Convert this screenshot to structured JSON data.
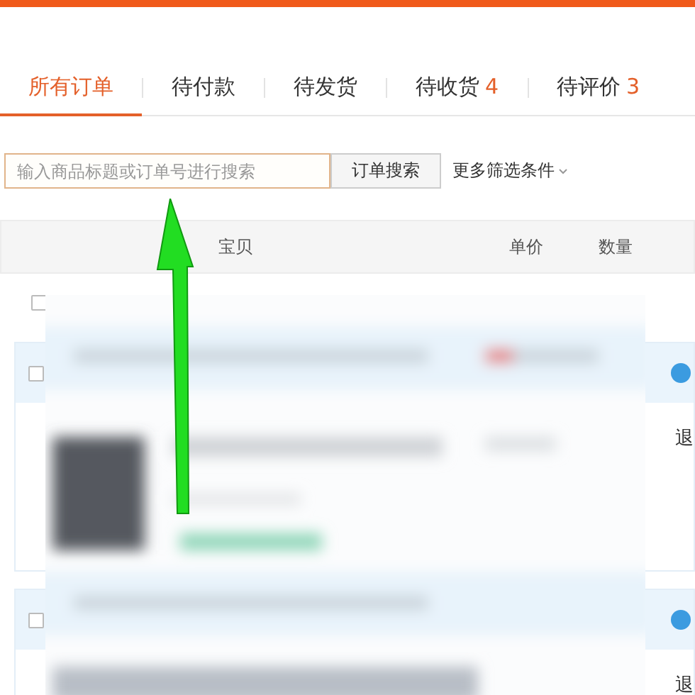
{
  "tabs": [
    {
      "label": "所有订单",
      "selected": true
    },
    {
      "label": "待付款",
      "selected": false
    },
    {
      "label": "待发货",
      "selected": false
    },
    {
      "label": "待收货",
      "count": "4",
      "selected": false
    },
    {
      "label": "待评价",
      "count": "3",
      "selected": false
    }
  ],
  "search": {
    "placeholder": "输入商品标题或订单号进行搜索",
    "button": "订单搜索",
    "more_filters": "更多筛选条件"
  },
  "columns": [
    "宝贝",
    "单价",
    "数量"
  ],
  "select_all": {
    "checked": false
  },
  "orders": [
    {
      "checked": false,
      "action": "退"
    },
    {
      "checked": false,
      "action": "退"
    }
  ]
}
